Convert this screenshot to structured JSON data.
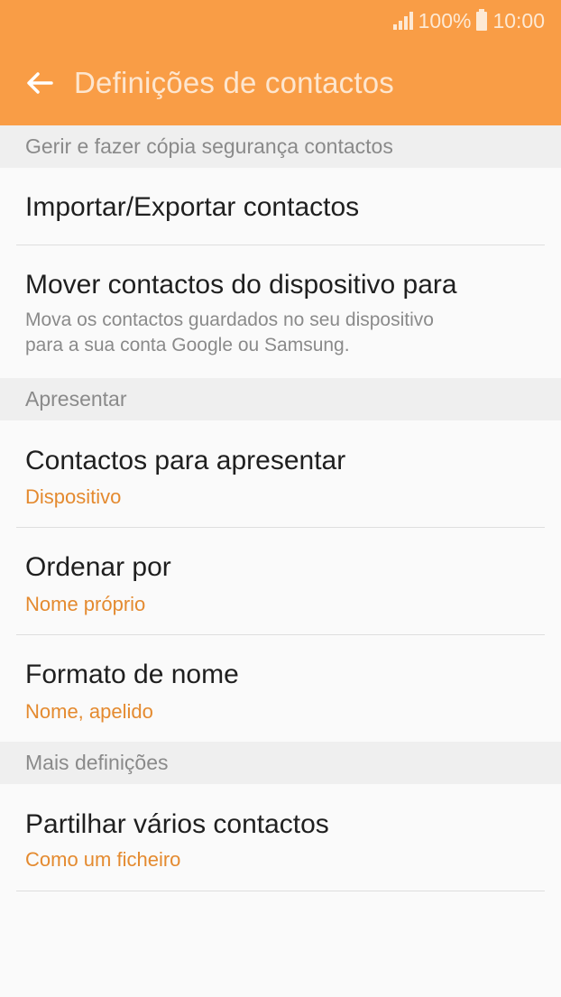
{
  "status": {
    "battery": "100%",
    "time": "10:00"
  },
  "colors": {
    "accent": "#f99d46",
    "value_text": "#e48a2f",
    "header_bg": "#efefef"
  },
  "toolbar": {
    "back_icon": "arrow-left-icon",
    "title": "Definições de contactos"
  },
  "sections": [
    {
      "header": "Gerir e fazer cópia segurança contactos",
      "items": [
        {
          "label": "Importar/Exportar contactos"
        },
        {
          "label": "Mover contactos do dispositivo para",
          "description_line1": "Mova os contactos guardados no seu dispositivo",
          "description_line2": "para a sua conta Google ou Samsung."
        }
      ]
    },
    {
      "header": "Apresentar",
      "items": [
        {
          "label": "Contactos para apresentar",
          "value": "Dispositivo"
        },
        {
          "label": "Ordenar por",
          "value": "Nome próprio"
        },
        {
          "label": "Formato de nome",
          "value": "Nome, apelido"
        }
      ]
    },
    {
      "header": "Mais definições",
      "items": [
        {
          "label": "Partilhar vários contactos",
          "value": "Como um ficheiro"
        }
      ]
    }
  ]
}
